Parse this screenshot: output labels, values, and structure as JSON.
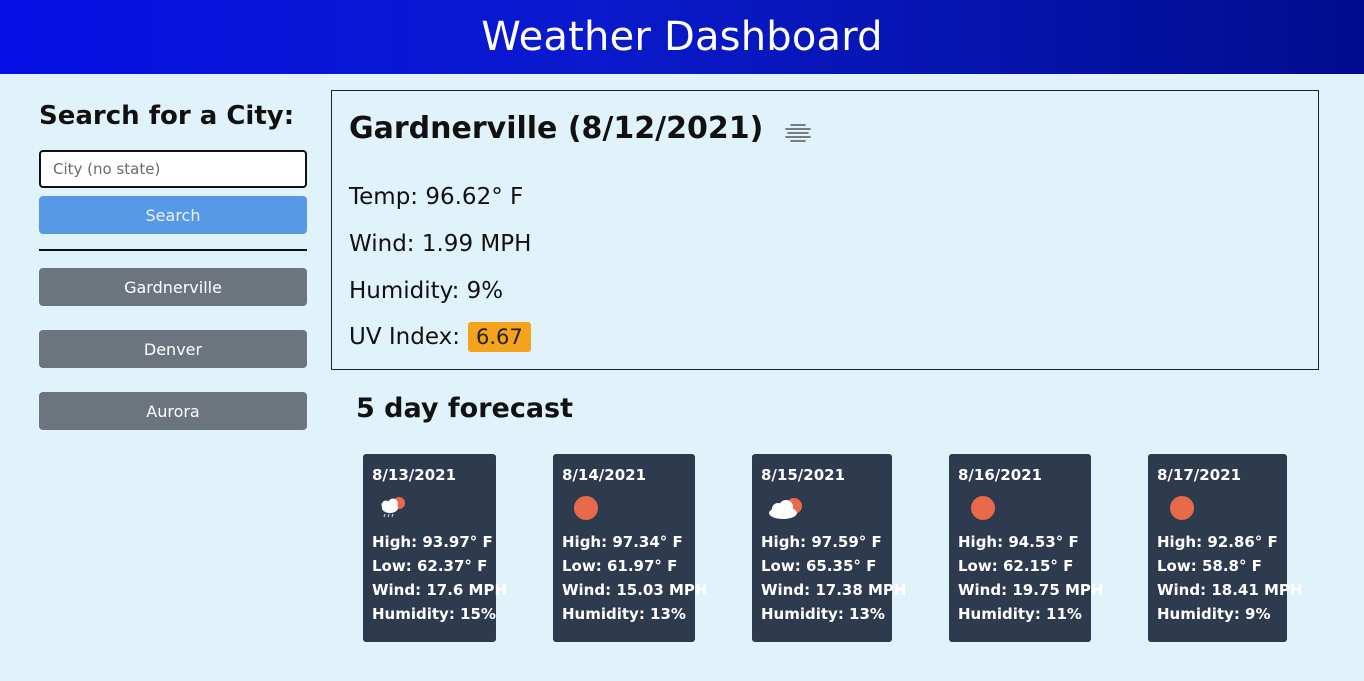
{
  "header": {
    "title": "Weather Dashboard"
  },
  "sidebar": {
    "heading": "Search for a City:",
    "search_placeholder": "City (no state)",
    "search_value": "",
    "search_label": "Search",
    "history": [
      "Gardnerville",
      "Denver",
      "Aurora"
    ]
  },
  "current": {
    "title": "Gardnerville (8/12/2021)",
    "icon": "fog-icon",
    "temp": "Temp: 96.62° F",
    "wind": "Wind: 1.99 MPH",
    "humidity": "Humidity: 9%",
    "uv_label": "UV Index:",
    "uv_value": "6.67",
    "uv_color": "#f5a21d"
  },
  "forecast": {
    "title": "5 day forecast",
    "days": [
      {
        "date": "8/13/2021",
        "icon": "rain-cloud-sun-icon",
        "high": "High: 93.97° F",
        "low": "Low: 62.37° F",
        "wind": "Wind: 17.6 MPH",
        "humidity": "Humidity: 15%"
      },
      {
        "date": "8/14/2021",
        "icon": "sun-icon",
        "high": "High: 97.34° F",
        "low": "Low: 61.97° F",
        "wind": "Wind: 15.03 MPH",
        "humidity": "Humidity: 13%"
      },
      {
        "date": "8/15/2021",
        "icon": "cloud-sun-icon",
        "high": "High: 97.59° F",
        "low": "Low: 65.35° F",
        "wind": "Wind: 17.38 MPH",
        "humidity": "Humidity: 13%"
      },
      {
        "date": "8/16/2021",
        "icon": "sun-icon",
        "high": "High: 94.53° F",
        "low": "Low: 62.15° F",
        "wind": "Wind: 19.75 MPH",
        "humidity": "Humidity: 11%"
      },
      {
        "date": "8/17/2021",
        "icon": "sun-icon",
        "high": "High: 92.86° F",
        "low": "Low: 58.8° F",
        "wind": "Wind: 18.41 MPH",
        "humidity": "Humidity: 9%"
      }
    ]
  },
  "colors": {
    "header_start": "#0610e6",
    "header_end": "#020c8e",
    "background": "#e0f3fb",
    "search_button": "#5899e6",
    "history_button": "#6c757d",
    "card_bg": "#2e3b4e",
    "sun": "#e86a4b"
  }
}
